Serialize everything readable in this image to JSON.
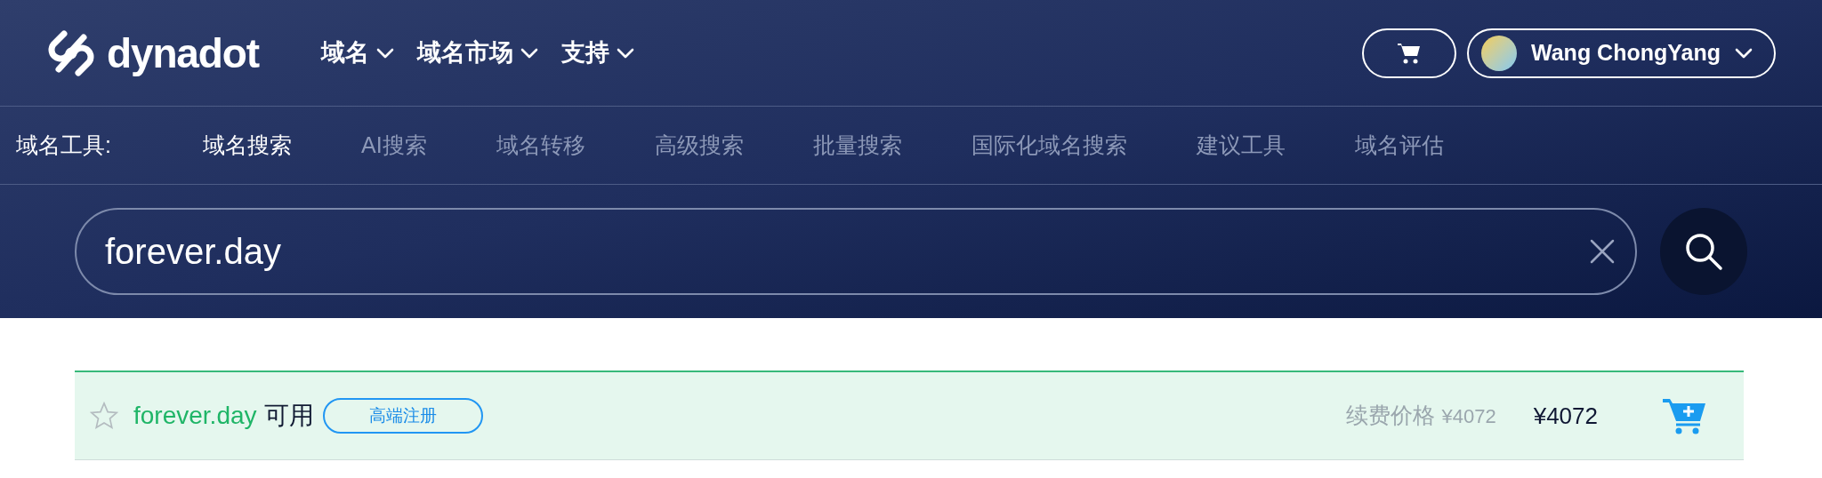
{
  "header": {
    "logo": "dynadot",
    "nav": [
      {
        "label": "域名"
      },
      {
        "label": "域名市场"
      },
      {
        "label": "支持"
      }
    ],
    "user": {
      "name": "Wang ChongYang"
    }
  },
  "tools": {
    "label": "域名工具:",
    "items": [
      {
        "label": "域名搜索",
        "selected": true
      },
      {
        "label": "AI搜索",
        "selected": false
      },
      {
        "label": "域名转移",
        "selected": false
      },
      {
        "label": "高级搜索",
        "selected": false
      },
      {
        "label": "批量搜索",
        "selected": false
      },
      {
        "label": "国际化域名搜索",
        "selected": false
      },
      {
        "label": "建议工具",
        "selected": false
      },
      {
        "label": "域名评估",
        "selected": false
      }
    ]
  },
  "search": {
    "value": "forever.day"
  },
  "results": [
    {
      "domain": "forever.day",
      "status": "可用",
      "badge": "高端注册",
      "renewal_label": "续费价格",
      "renewal_price": "¥4072",
      "price": "¥4072",
      "favorite": false
    }
  ]
}
